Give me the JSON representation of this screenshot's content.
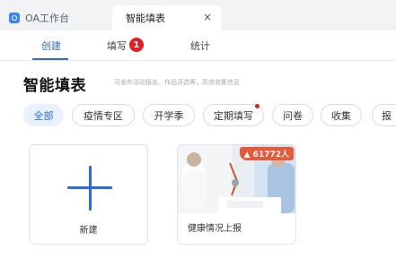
{
  "tabs": [
    {
      "label": "OA工作台",
      "icon": "app-icon"
    },
    {
      "label": "智能填表",
      "close_icon": "×"
    }
  ],
  "subtabs": [
    {
      "label": "创建",
      "active": true
    },
    {
      "label": "填写",
      "badge": "1"
    },
    {
      "label": "统计"
    }
  ],
  "page": {
    "title": "智能填表",
    "subtitle": "可发布活动报名、作品评选等，高效收集信息"
  },
  "chips": [
    {
      "label": "全部",
      "active": true
    },
    {
      "label": "疫情专区"
    },
    {
      "label": "开学季"
    },
    {
      "label": "定期填写",
      "dot": true
    },
    {
      "label": "问卷"
    },
    {
      "label": "收集"
    },
    {
      "label": "报"
    }
  ],
  "cards": [
    {
      "label": "新建",
      "icon": "plus-icon"
    },
    {
      "label": "健康情况上报",
      "views": "▲ 61772人"
    }
  ],
  "colors": {
    "accent": "#2f6bd8",
    "badge": "#e02020",
    "chip_active_bg": "#e8f1fd",
    "views_badge": "#e55a3a"
  }
}
